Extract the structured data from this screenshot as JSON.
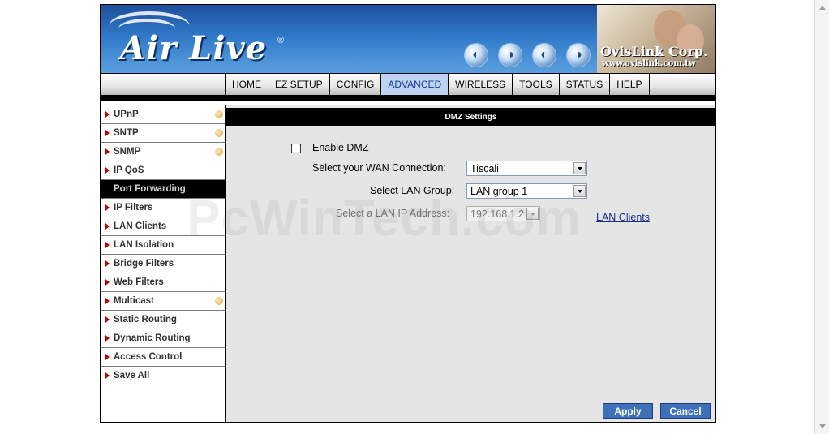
{
  "header": {
    "brand": "Air Live",
    "brand_reg": "®",
    "corp_name": "OvisLink Corp.",
    "corp_url": "www.ovislink.com.tw",
    "globe_icons": [
      "globe-icon",
      "globe-icon",
      "globe-icon",
      "globe-icon"
    ]
  },
  "nav": {
    "tabs": [
      {
        "label": "HOME"
      },
      {
        "label": "EZ SETUP"
      },
      {
        "label": "CONFIG"
      },
      {
        "label": "ADVANCED",
        "active": true
      },
      {
        "label": "WIRELESS"
      },
      {
        "label": "TOOLS"
      },
      {
        "label": "STATUS"
      },
      {
        "label": "HELP"
      }
    ]
  },
  "sidebar": {
    "items": [
      {
        "label": "UPnP",
        "has_dot": true
      },
      {
        "label": "SNTP",
        "has_dot": true
      },
      {
        "label": "SNMP",
        "has_dot": true
      },
      {
        "label": "IP QoS"
      },
      {
        "label": "Port Forwarding",
        "active": true
      },
      {
        "label": "IP Filters"
      },
      {
        "label": "LAN Clients"
      },
      {
        "label": "LAN Isolation"
      },
      {
        "label": "Bridge Filters"
      },
      {
        "label": "Web Filters"
      },
      {
        "label": "Multicast",
        "has_dot": true
      },
      {
        "label": "Static Routing"
      },
      {
        "label": "Dynamic Routing"
      },
      {
        "label": "Access Control"
      },
      {
        "label": "Save All"
      }
    ]
  },
  "main": {
    "title": "DMZ Settings",
    "enable_dmz_label": "Enable DMZ",
    "wan_label": "Select your WAN Connection:",
    "wan_value": "Tiscali",
    "lan_group_label": "Select LAN Group:",
    "lan_group_value": "LAN group 1",
    "lan_ip_label": "Select a LAN IP Address:",
    "lan_ip_value": "192.168.1.2",
    "lan_clients_link": "LAN Clients",
    "apply_label": "Apply",
    "cancel_label": "Cancel"
  },
  "watermark": "PcWinTech.com",
  "colors": {
    "accent": "#3d70b9",
    "active_tab_bg": "#bcd3f2",
    "active_side_bg": "#000000",
    "arrow": "#c00000"
  }
}
